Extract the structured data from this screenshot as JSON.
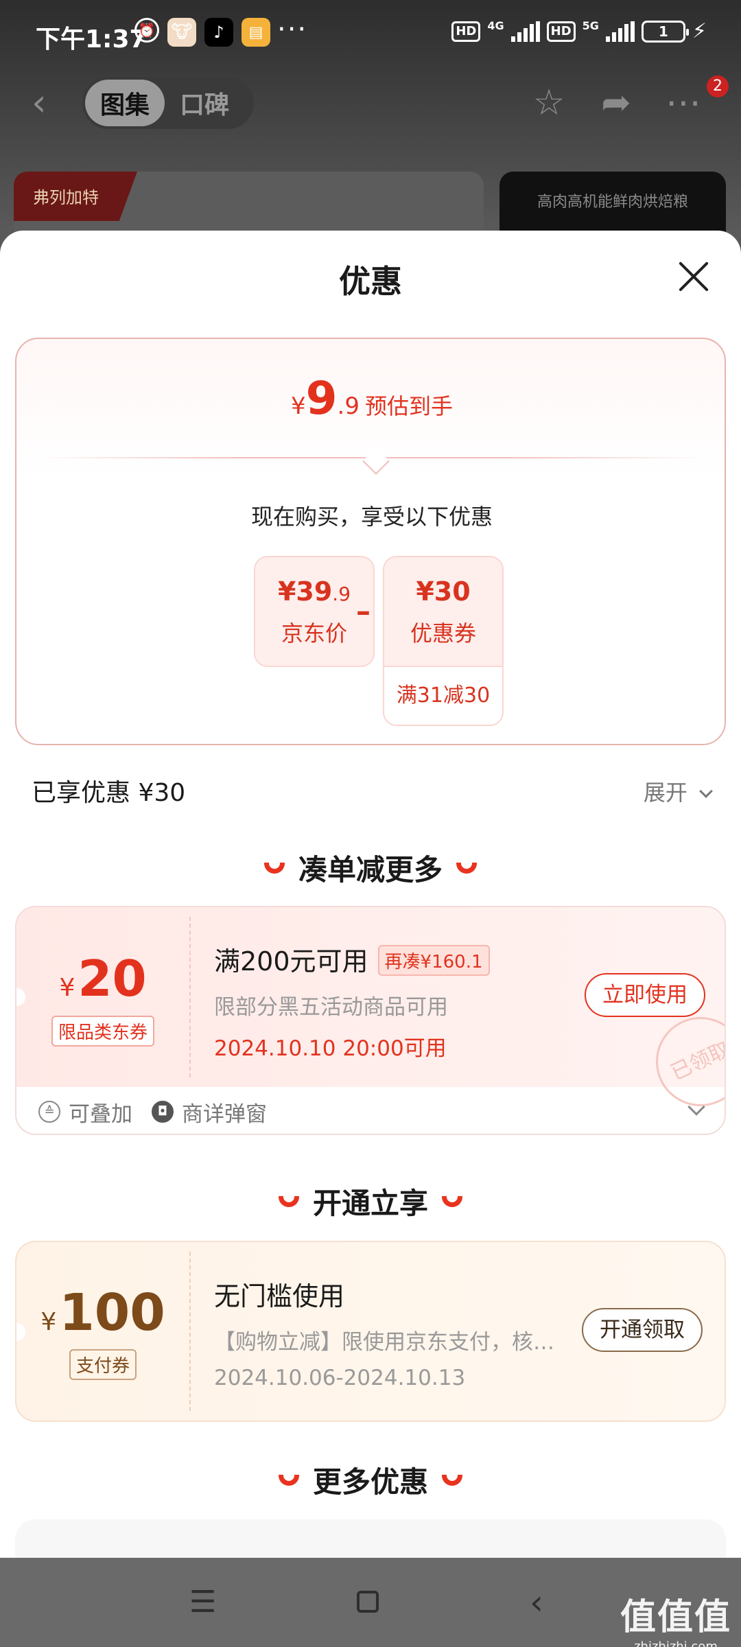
{
  "status_bar": {
    "time": "下午1:37",
    "more": "···",
    "network_1": "4G",
    "network_2": "5G",
    "hd": "HD",
    "battery": "1"
  },
  "nav": {
    "tabs": [
      "图集",
      "口碑"
    ],
    "active_tab": 0,
    "badge_count": "2"
  },
  "background": {
    "left_card_brand": "弗列加特",
    "right_card_title": "高肉高机能鲜肉烘焙粮"
  },
  "sheet": {
    "title": "优惠",
    "estimate": {
      "currency": "¥",
      "integer": "9",
      "decimal": ".9",
      "label": "预估到手"
    },
    "buy_now_text": "现在购买，享受以下优惠",
    "calc": {
      "price_value": "¥39",
      "price_decimal": ".9",
      "price_label": "京东价",
      "minus": "–",
      "coupon_value": "¥30",
      "coupon_label": "优惠券",
      "coupon_condition": "满31减30"
    },
    "enjoyed": "已享优惠 ¥30",
    "expand": "展开",
    "sections": {
      "more_orders": "凑单减更多",
      "open_enjoy": "开通立享",
      "more_discounts": "更多优惠"
    },
    "coupon_1": {
      "currency": "¥",
      "amount": "20",
      "tag": "限品类东券",
      "title": "满200元可用",
      "chip": "再凑¥160.1",
      "desc": "限部分黑五活动商品可用",
      "time": "2024.10.10 20:00可用",
      "button": "立即使用",
      "stamp": "已领取",
      "foot_1": "可叠加",
      "foot_2": "商详弹窗"
    },
    "coupon_2": {
      "currency": "¥",
      "amount": "100",
      "tag": "支付券",
      "title": "无门槛使用",
      "desc": "【购物立减】限使用京东支付，核…",
      "time": "2024.10.06-2024.10.13",
      "button": "开通领取"
    }
  },
  "watermark": {
    "big": "值值值",
    "small": "zhizhizhi.com"
  },
  "colors": {
    "accent_red": "#e2321e",
    "coupon_brown": "#8a4a12"
  }
}
